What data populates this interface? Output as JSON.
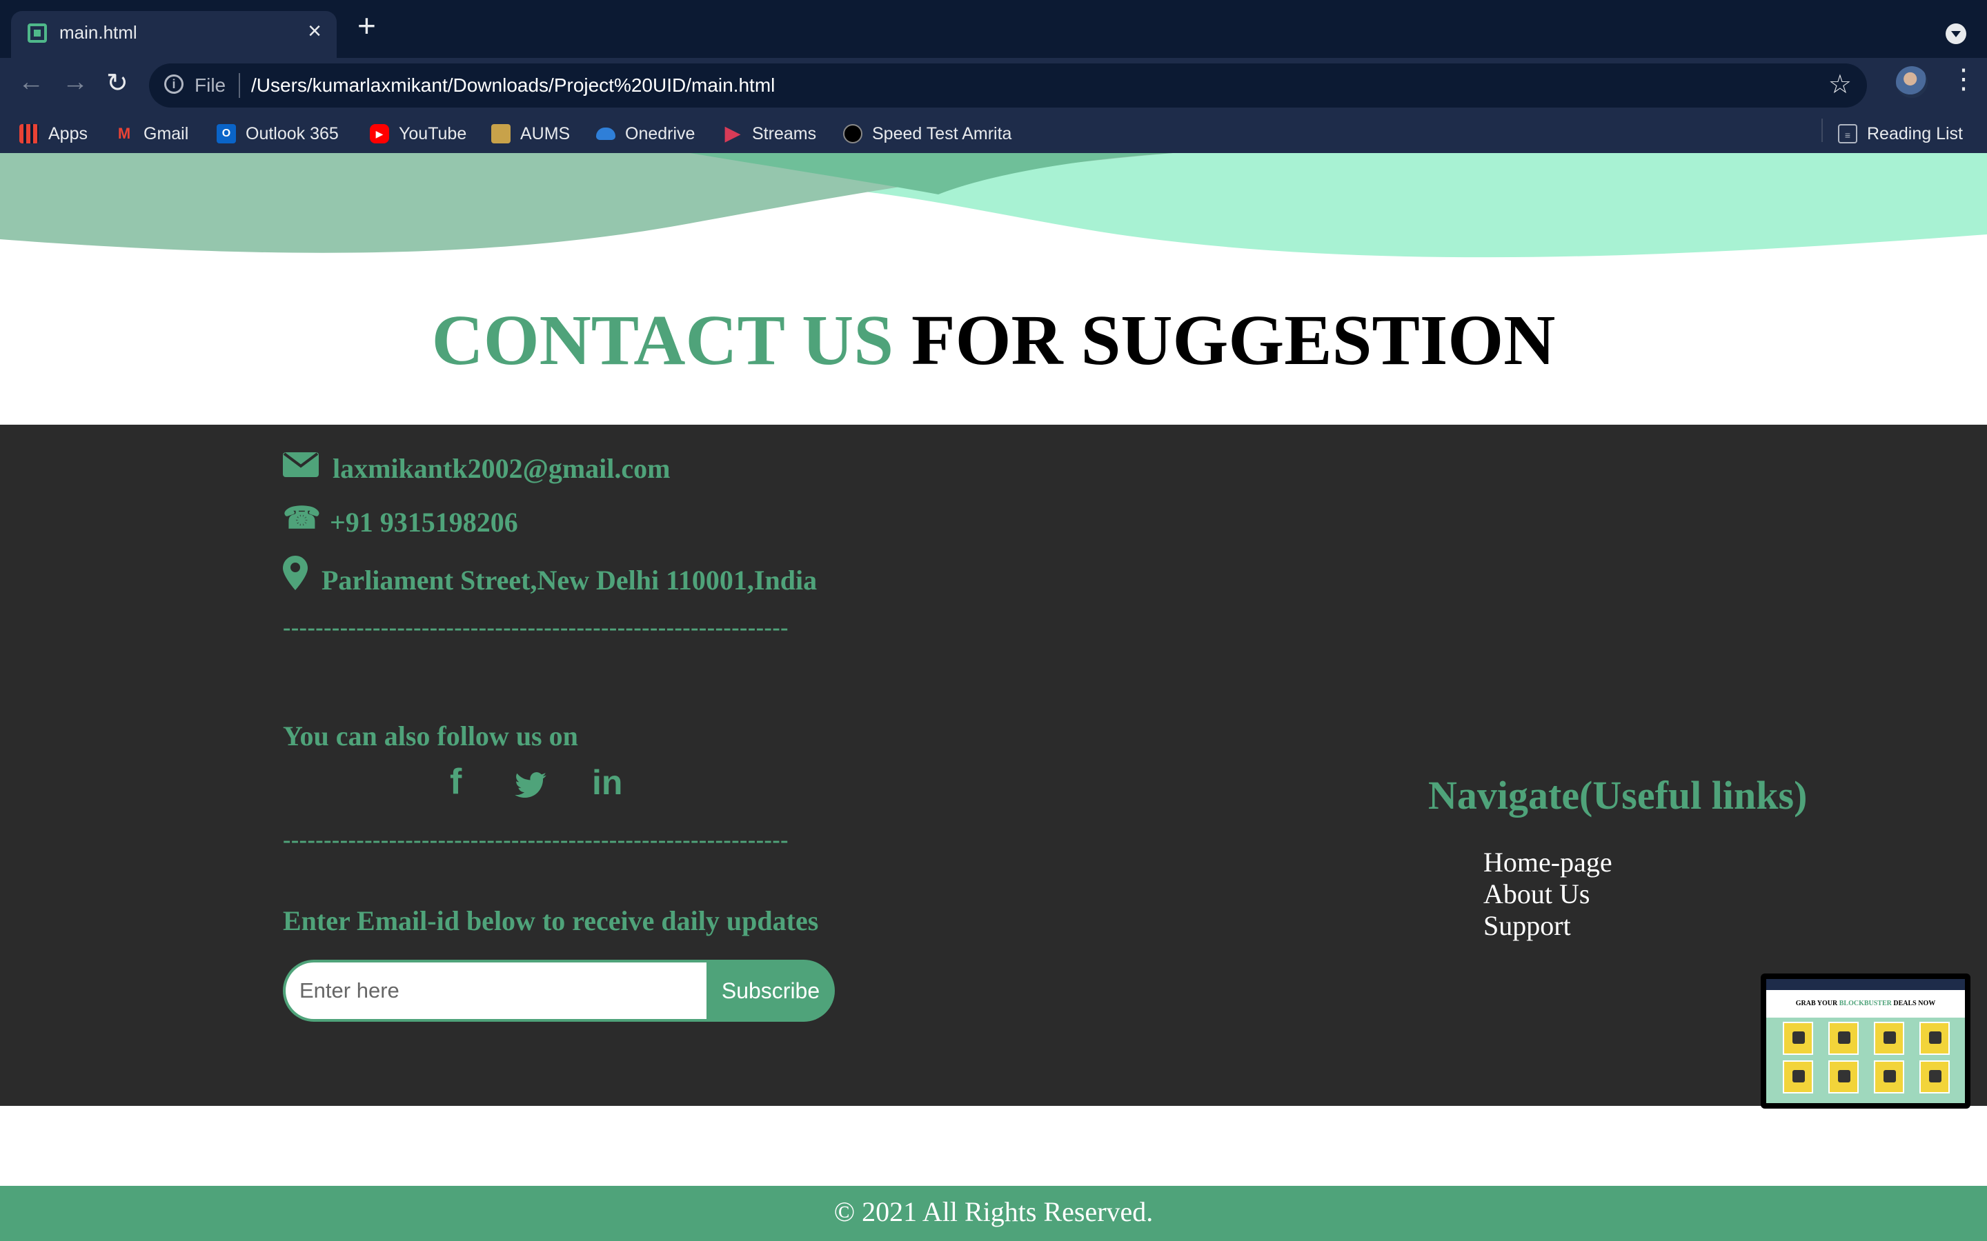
{
  "browser": {
    "tab_title": "main.html",
    "tab_close": "×",
    "new_tab": "+",
    "address_scheme": "File",
    "address_url": "/Users/kumarlaxmikant/Downloads/Project%20UID/main.html",
    "bookmarks": [
      {
        "label": "Apps",
        "icon": "apps-grid-icon"
      },
      {
        "label": "Gmail",
        "icon": "gmail-icon"
      },
      {
        "label": "Outlook 365",
        "icon": "outlook-icon"
      },
      {
        "label": "YouTube",
        "icon": "youtube-icon"
      },
      {
        "label": "AUMS",
        "icon": "aums-icon"
      },
      {
        "label": "Onedrive",
        "icon": "onedrive-icon"
      },
      {
        "label": "Streams",
        "icon": "streams-icon"
      },
      {
        "label": "Speed Test Amrita",
        "icon": "speedtest-icon"
      }
    ],
    "reading_list": "Reading List"
  },
  "page": {
    "heading_accent": "CONTACT US",
    "heading_rest": " FOR SUGGESTION",
    "contact": {
      "email": "laxmikantk2002@gmail.com",
      "phone": "+91 9315198206",
      "address": "Parliament Street,New Delhi 110001,India"
    },
    "divider": "--------------------------------------------------------------",
    "follow_title": "You can also follow us on",
    "social": [
      {
        "name": "facebook",
        "glyph": "f"
      },
      {
        "name": "twitter",
        "glyph": ""
      },
      {
        "name": "linkedin",
        "glyph": "in"
      }
    ],
    "updates_title": "Enter Email-id below to receive daily updates",
    "email_placeholder": "Enter here",
    "subscribe_label": "Subscribe",
    "nav_title": "Navigate(Useful links)",
    "nav_links": [
      "Home-page",
      "About Us",
      "Support"
    ],
    "copyright": "© 2021 All Rights Reserved.",
    "thumbnail": {
      "title_start": "GRAB YOUR ",
      "title_accent": "BLOCKBUSTER",
      "title_end": " DEALS NOW"
    }
  },
  "colors": {
    "accent": "#4fa37a",
    "footer_bg": "#2b2b2b",
    "chrome_dark": "#0c1a33",
    "chrome_toolbar": "#1e2c4a"
  }
}
